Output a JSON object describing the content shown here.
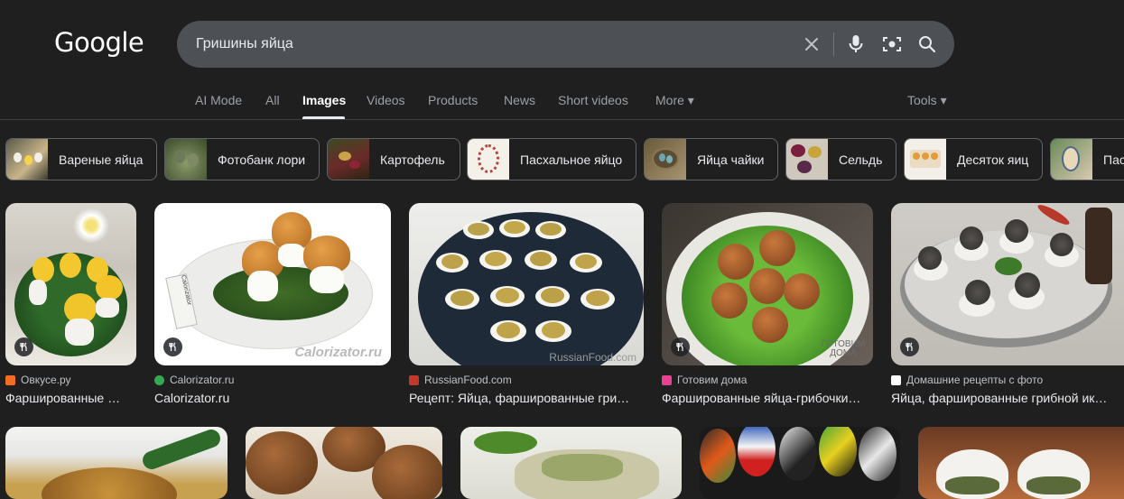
{
  "logo": "Google",
  "search": {
    "query": "Гришины яйца",
    "icons": [
      "clear-icon",
      "microphone-icon",
      "lens-icon",
      "search-icon"
    ]
  },
  "tabs": [
    {
      "label": "AI Mode"
    },
    {
      "label": "All"
    },
    {
      "label": "Images",
      "active": true
    },
    {
      "label": "Videos"
    },
    {
      "label": "Products"
    },
    {
      "label": "News"
    },
    {
      "label": "Short videos"
    },
    {
      "label": "More ▾"
    }
  ],
  "tools": "Tools ▾",
  "chips": [
    {
      "label": "Вареные яйца"
    },
    {
      "label": "Фотобанк лори"
    },
    {
      "label": "Картофель"
    },
    {
      "label": "Пасхальное яйцо"
    },
    {
      "label": "Яйца чайки"
    },
    {
      "label": "Сельдь"
    },
    {
      "label": "Десяток яиц"
    },
    {
      "label": "Пас"
    }
  ],
  "results": [
    {
      "source": "Овкусе.ру",
      "title": "Фаршированные …",
      "favicon_color": "#f36c21",
      "watermark": ""
    },
    {
      "source": "Calorizator.ru",
      "title": "Calorizator.ru",
      "favicon_color": "#34a853",
      "watermark": "Calorizator.ru"
    },
    {
      "source": "RussianFood.com",
      "title": "Рецепт: Яйца, фаршированные гри…",
      "favicon_color": "#c0392b",
      "watermark": "RussianFood.com"
    },
    {
      "source": "Готовим дома",
      "title": "Фаршированные яйца-грибочки…",
      "favicon_color": "#e84393",
      "watermark": "ГОТОВИМ ДОМА"
    },
    {
      "source": "Домашние рецепты с фото",
      "title": "Яйца, фаршированные грибной ик…",
      "favicon_color": "#ffffff",
      "watermark": ""
    }
  ]
}
